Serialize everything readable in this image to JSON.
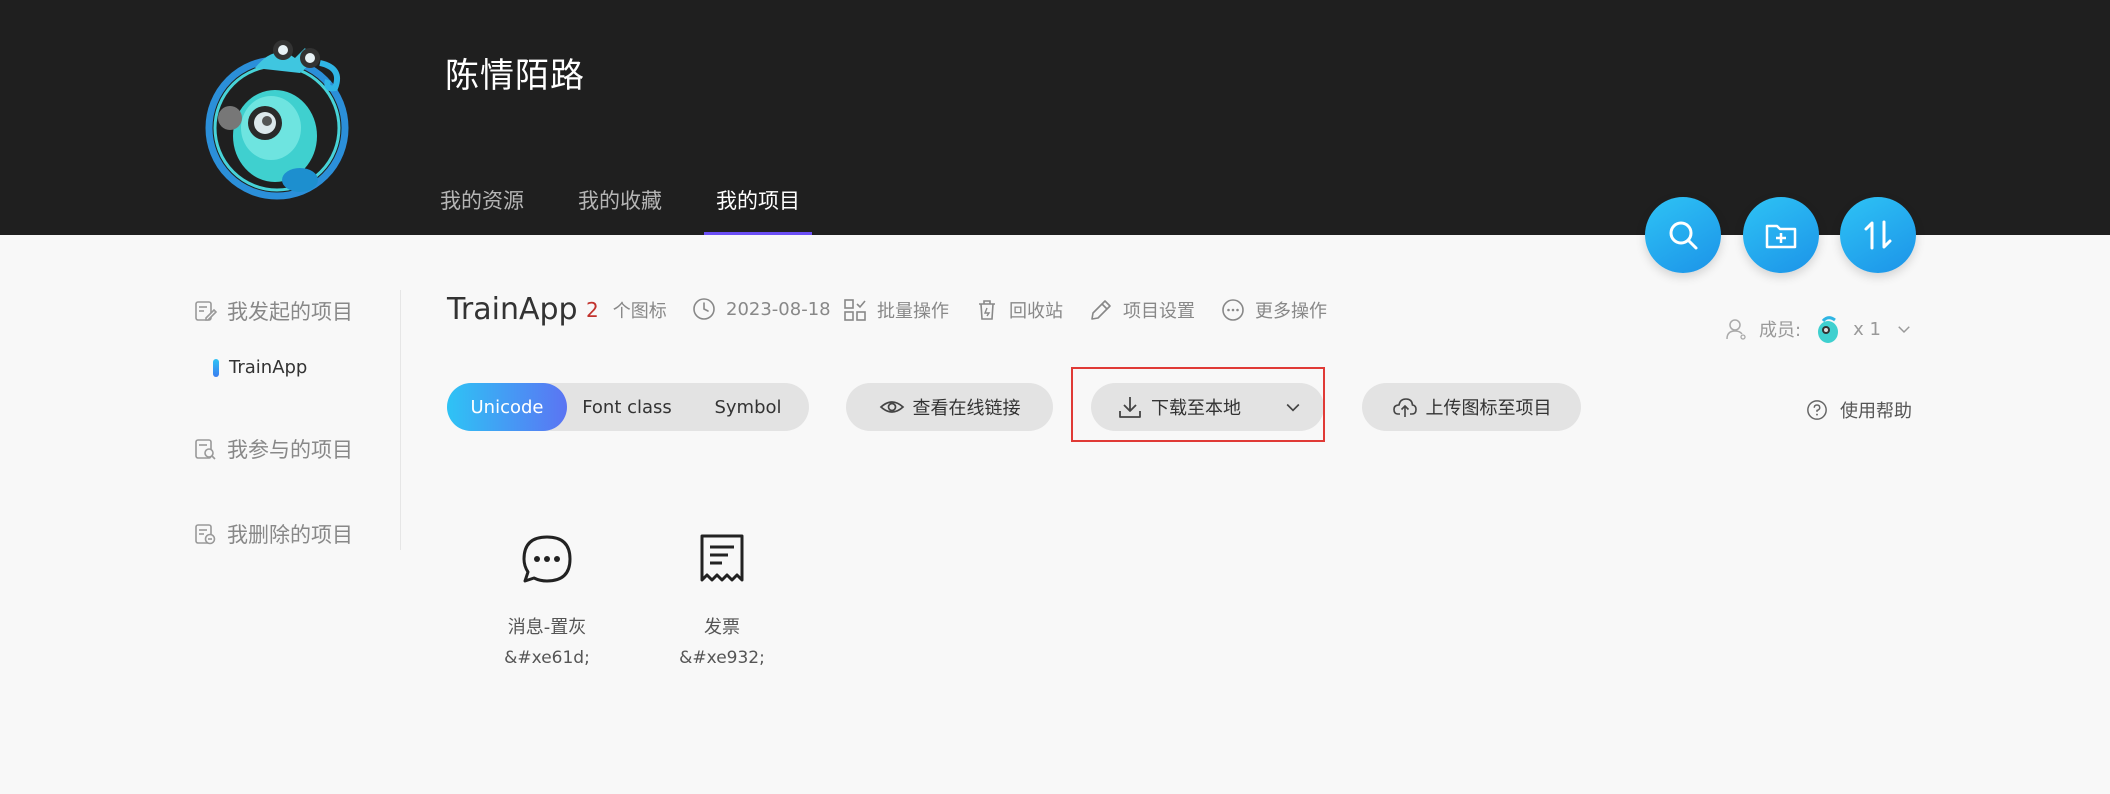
{
  "header": {
    "username": "陈情陌路",
    "tabs": [
      {
        "label": "我的资源",
        "active": false
      },
      {
        "label": "我的收藏",
        "active": false
      },
      {
        "label": "我的项目",
        "active": true
      }
    ],
    "actions": [
      "search-icon",
      "add-folder-icon",
      "sort-icon"
    ]
  },
  "sidebar": {
    "started": "我发起的项目",
    "current_project": "TrainApp",
    "joined": "我参与的项目",
    "deleted": "我删除的项目"
  },
  "project": {
    "title": "TrainApp",
    "icon_count": "2",
    "icon_count_suffix": "个图标",
    "date": "2023-08-18",
    "batch": "批量操作",
    "recycle": "回收站",
    "settings": "项目设置",
    "more": "更多操作",
    "members_label": "成员:",
    "members_count": "x 1"
  },
  "toolbar": {
    "tabs": [
      "Unicode",
      "Font class",
      "Symbol"
    ],
    "active_tab": "Unicode",
    "view_link": "查看在线链接",
    "download": "下载至本地",
    "upload": "上传图标至项目",
    "help": "使用帮助"
  },
  "icons": [
    {
      "name": "消息-置灰",
      "code": "&#xe61d;",
      "icon": "message-icon"
    },
    {
      "name": "发票",
      "code": "&#xe932;",
      "icon": "invoice-icon"
    }
  ],
  "colors": {
    "header_bg": "#1f1f1f",
    "accent_gradient_start": "#2ec3f5",
    "accent_gradient_end": "#5b74f3",
    "nav_underline": "#6b4ff5",
    "highlight_border": "#e03a36",
    "count_red": "#c2332e"
  }
}
